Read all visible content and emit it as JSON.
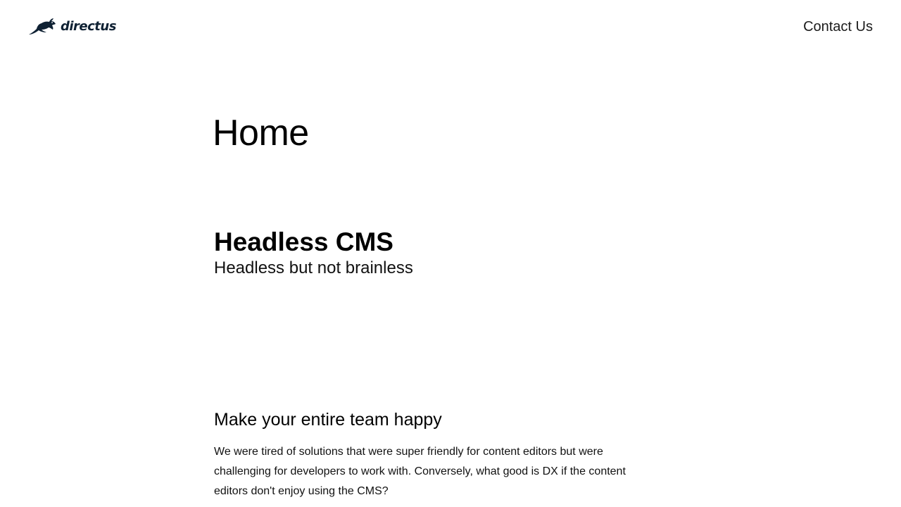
{
  "header": {
    "brand_name": "directus",
    "brand_icon": "rabbit-logo-icon",
    "brand_color": "#0f2133",
    "nav": {
      "contact_label": "Contact Us"
    }
  },
  "main": {
    "page_title": "Home",
    "hero": {
      "title": "Headless CMS",
      "subtitle": "Headless but not brainless"
    },
    "feature": {
      "title": "Make your entire team happy",
      "body": "We were tired of solutions that were super friendly for content editors but were challenging for developers to work with. Conversely, what good is DX if the content editors don't enjoy using the CMS?"
    }
  }
}
